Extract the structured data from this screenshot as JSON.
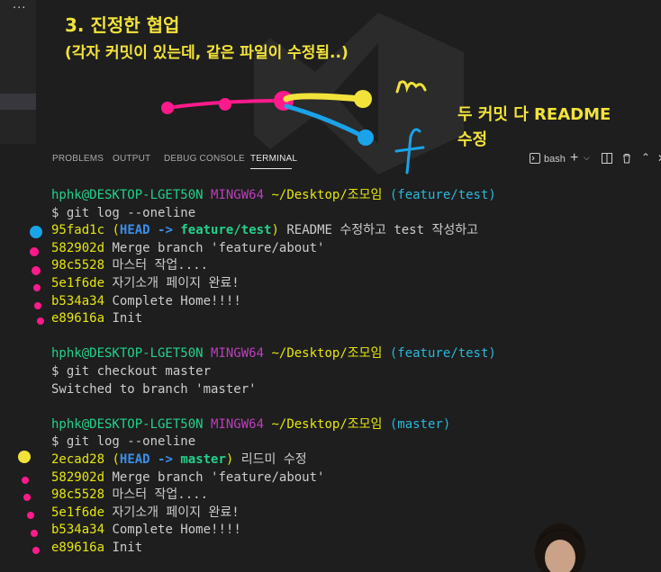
{
  "annotations": {
    "title": "3. 진정한 협업",
    "subtitle": "(각자 커밋이 있는데, 같은 파일이 수정됨..)",
    "side_line1": "두 커밋 다 README",
    "side_line2": "수정",
    "branch_m": "m",
    "branch_f": "f"
  },
  "sidebar": {
    "more_glyph": "···"
  },
  "panel": {
    "tabs": [
      "PROBLEMS",
      "OUTPUT",
      "DEBUG CONSOLE",
      "TERMINAL"
    ],
    "active_tab": "TERMINAL",
    "shell_label": "bash",
    "icons": [
      "terminal-icon",
      "plus-icon",
      "chevron-down-icon",
      "split-icon",
      "trash-icon",
      "maximize-icon",
      "close-icon"
    ]
  },
  "terminal": {
    "p1": {
      "user": "hphk@DESKTOP-LGET50N",
      "env": "MINGW64",
      "path": "~/Desktop/조모임",
      "branch": "(feature/test)"
    },
    "cmd1": "$ git log --oneline",
    "log1": [
      {
        "hash": "95fad1c",
        "open": "(",
        "head": "HEAD ->",
        "ref": "feature/test",
        "close": ")",
        "msg": "README 수정하고 test 작성하고"
      },
      {
        "hash": "582902d",
        "msg": "Merge branch 'feature/about'"
      },
      {
        "hash": "98c5528",
        "msg": "마스터 작업...."
      },
      {
        "hash": "5e1f6de",
        "msg": "자기소개 페이지 완료!"
      },
      {
        "hash": "b534a34",
        "msg": "Complete Home!!!!"
      },
      {
        "hash": "e89616a",
        "msg": "Init"
      }
    ],
    "p2": {
      "user": "hphk@DESKTOP-LGET50N",
      "env": "MINGW64",
      "path": "~/Desktop/조모임",
      "branch": "(feature/test)"
    },
    "cmd2": "$ git checkout master",
    "out2": "Switched to branch 'master'",
    "p3": {
      "user": "hphk@DESKTOP-LGET50N",
      "env": "MINGW64",
      "path": "~/Desktop/조모임",
      "branch": "(master)"
    },
    "cmd3": "$ git log --oneline",
    "log2": [
      {
        "hash": "2ecad28",
        "open": "(",
        "head": "HEAD ->",
        "ref": "master",
        "close": ")",
        "msg": "리드미 수정"
      },
      {
        "hash": "582902d",
        "msg": "Merge branch 'feature/about'"
      },
      {
        "hash": "98c5528",
        "msg": "마스터 작업...."
      },
      {
        "hash": "5e1f6de",
        "msg": "자기소개 페이지 완료!"
      },
      {
        "hash": "b534a34",
        "msg": "Complete Home!!!!"
      },
      {
        "hash": "e89616a",
        "msg": "Init"
      }
    ]
  },
  "colors": {
    "annotation_yellow": "#f2e33a",
    "annotation_pink": "#ff1a8c",
    "annotation_blue": "#1aa3e8",
    "prompt_green": "#23d18b",
    "prompt_purple": "#bc3fbc",
    "path_yellow": "#e5e510",
    "branch_cyan": "#29b8db",
    "head_blue": "#3b8eea"
  }
}
